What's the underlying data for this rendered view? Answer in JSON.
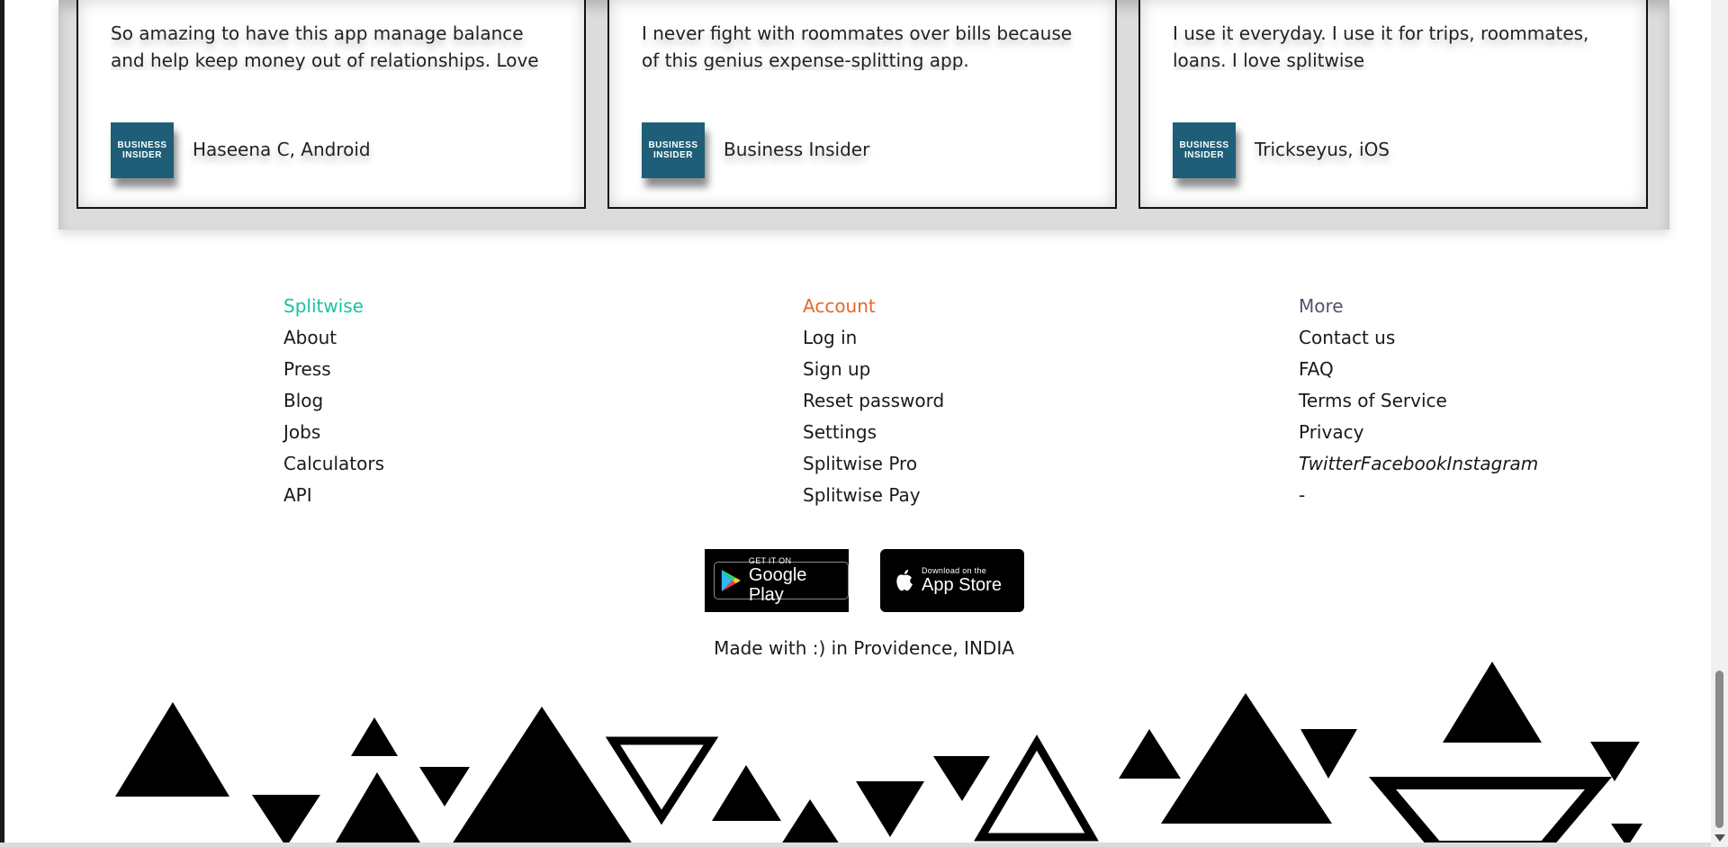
{
  "testimonials": [
    {
      "quote": "So amazing to have this app manage balance and help keep money out of relationships. Love it!",
      "author": "Haseena C, Android",
      "avatar_label": "BUSINESS INSIDER"
    },
    {
      "quote": "I never fight with roommates over bills because of this genius expense-splitting app.",
      "author": "Business Insider",
      "avatar_label": "BUSINESS INSIDER"
    },
    {
      "quote": "I use it everyday. I use it for trips, roommates, loans. I love splitwise",
      "author": "Trickseyus, iOS",
      "avatar_label": "BUSINESS INSIDER"
    }
  ],
  "footer": {
    "splitwise": {
      "heading": "Splitwise",
      "color": "#1cc29f",
      "links": [
        "About",
        "Press",
        "Blog",
        "Jobs",
        "Calculators",
        "API"
      ]
    },
    "account": {
      "heading": "Account",
      "color": "#e4672b",
      "links": [
        "Log in",
        "Sign up",
        "Reset password",
        "Settings",
        "Splitwise Pro",
        "Splitwise Pay"
      ]
    },
    "more": {
      "heading": "More",
      "color": "#4f5569",
      "links": [
        "Contact us",
        "FAQ",
        "Terms of Service",
        "Privacy"
      ],
      "social": [
        "Twitter",
        "Facebook",
        "Instagram"
      ],
      "dash": "-"
    }
  },
  "badges": {
    "google": {
      "small": "GET IT ON",
      "big": "Google Play",
      "icon": "google-play-icon"
    },
    "apple": {
      "small": "Download on the",
      "big": "App Store",
      "icon": "apple-icon"
    }
  },
  "made_with": "Made with :) in Providence, INDIA"
}
